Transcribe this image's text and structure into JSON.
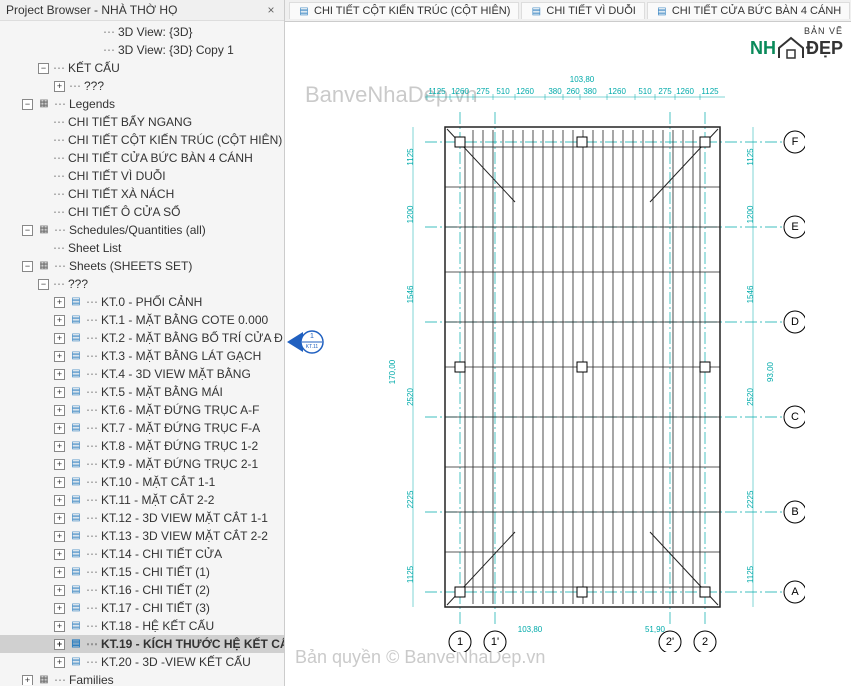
{
  "sidebar": {
    "title": "Project Browser - NHÀ THỜ HỌ",
    "close": "×",
    "tree": [
      {
        "indent": 5,
        "expander": "",
        "icon": "",
        "label": "3D View: {3D}",
        "active": false
      },
      {
        "indent": 5,
        "expander": "",
        "icon": "",
        "label": "3D View: {3D} Copy 1",
        "active": false
      },
      {
        "indent": 2,
        "expander": "−",
        "icon": "",
        "label": "KẾT CẤU",
        "active": false
      },
      {
        "indent": 3,
        "expander": "+",
        "icon": "",
        "label": "???",
        "active": false
      },
      {
        "indent": 1,
        "expander": "−",
        "icon": "folder",
        "label": "Legends",
        "active": false
      },
      {
        "indent": 2,
        "expander": "",
        "icon": "",
        "label": "CHI TIẾT BẨY NGANG",
        "active": false
      },
      {
        "indent": 2,
        "expander": "",
        "icon": "",
        "label": "CHI TIẾT CỘT KIẾN TRÚC (CỘT HIÊN)",
        "active": false
      },
      {
        "indent": 2,
        "expander": "",
        "icon": "",
        "label": "CHI TIẾT CỬA BỨC BÀN 4 CÁNH",
        "active": false
      },
      {
        "indent": 2,
        "expander": "",
        "icon": "",
        "label": "CHI TIẾT VÌ DUỖI",
        "active": false
      },
      {
        "indent": 2,
        "expander": "",
        "icon": "",
        "label": "CHI TIẾT XÀ NÁCH",
        "active": false
      },
      {
        "indent": 2,
        "expander": "",
        "icon": "",
        "label": "CHI TIẾT Ô CỬA SỔ",
        "active": false
      },
      {
        "indent": 1,
        "expander": "−",
        "icon": "folder",
        "label": "Schedules/Quantities (all)",
        "active": false
      },
      {
        "indent": 2,
        "expander": "",
        "icon": "",
        "label": "Sheet List",
        "active": false
      },
      {
        "indent": 1,
        "expander": "−",
        "icon": "folder",
        "label": "Sheets (SHEETS SET)",
        "active": false
      },
      {
        "indent": 2,
        "expander": "−",
        "icon": "",
        "label": "???",
        "active": false
      },
      {
        "indent": 3,
        "expander": "+",
        "icon": "sheet",
        "label": "KT.0 - PHỐI CẢNH",
        "active": false
      },
      {
        "indent": 3,
        "expander": "+",
        "icon": "sheet",
        "label": "KT.1 - MẶT BẰNG COTE 0.000",
        "active": false
      },
      {
        "indent": 3,
        "expander": "+",
        "icon": "sheet",
        "label": "KT.2 - MẶT BẰNG BỐ TRÍ CỬA Đ",
        "active": false
      },
      {
        "indent": 3,
        "expander": "+",
        "icon": "sheet",
        "label": "KT.3 - MẶT BẰNG LÁT GẠCH",
        "active": false
      },
      {
        "indent": 3,
        "expander": "+",
        "icon": "sheet",
        "label": "KT.4 - 3D VIEW MẶT BẰNG",
        "active": false
      },
      {
        "indent": 3,
        "expander": "+",
        "icon": "sheet",
        "label": "KT.5 - MẶT BẰNG MÁI",
        "active": false
      },
      {
        "indent": 3,
        "expander": "+",
        "icon": "sheet",
        "label": "KT.6 - MẶT ĐỨNG TRỤC A-F",
        "active": false
      },
      {
        "indent": 3,
        "expander": "+",
        "icon": "sheet",
        "label": "KT.7 - MẶT ĐỨNG TRỤC F-A",
        "active": false
      },
      {
        "indent": 3,
        "expander": "+",
        "icon": "sheet",
        "label": "KT.8 - MẶT ĐỨNG TRỤC 1-2",
        "active": false
      },
      {
        "indent": 3,
        "expander": "+",
        "icon": "sheet",
        "label": "KT.9 - MẶT ĐỨNG TRỤC 2-1",
        "active": false
      },
      {
        "indent": 3,
        "expander": "+",
        "icon": "sheet",
        "label": "KT.10 - MẶT CẮT 1-1",
        "active": false
      },
      {
        "indent": 3,
        "expander": "+",
        "icon": "sheet",
        "label": "KT.11 - MẶT CẮT 2-2",
        "active": false
      },
      {
        "indent": 3,
        "expander": "+",
        "icon": "sheet",
        "label": "KT.12 - 3D VIEW MẶT CẮT 1-1",
        "active": false
      },
      {
        "indent": 3,
        "expander": "+",
        "icon": "sheet",
        "label": "KT.13 - 3D VIEW MẶT CẮT 2-2",
        "active": false
      },
      {
        "indent": 3,
        "expander": "+",
        "icon": "sheet",
        "label": "KT.14 - CHI TIẾT CỬA",
        "active": false
      },
      {
        "indent": 3,
        "expander": "+",
        "icon": "sheet",
        "label": "KT.15 - CHI TIẾT (1)",
        "active": false
      },
      {
        "indent": 3,
        "expander": "+",
        "icon": "sheet",
        "label": "KT.16 - CHI TIẾT (2)",
        "active": false
      },
      {
        "indent": 3,
        "expander": "+",
        "icon": "sheet",
        "label": "KT.17 - CHI TIẾT (3)",
        "active": false
      },
      {
        "indent": 3,
        "expander": "+",
        "icon": "sheet",
        "label": "KT.18 - HỆ KẾT CẤU",
        "active": false
      },
      {
        "indent": 3,
        "expander": "+",
        "icon": "sheet",
        "label": "KT.19 - KÍCH THƯỚC HỆ KẾT CẤ",
        "active": true
      },
      {
        "indent": 3,
        "expander": "+",
        "icon": "sheet",
        "label": "KT.20 - 3D -VIEW KẾT CẤU",
        "active": false
      },
      {
        "indent": 1,
        "expander": "+",
        "icon": "folder",
        "label": "Families",
        "active": false
      }
    ]
  },
  "tabs": [
    {
      "label": "CHI TIẾT CỘT KIẾN TRÚC (CỘT HIÊN)"
    },
    {
      "label": "CHI TIẾT VÌ DUỖI"
    },
    {
      "label": "CHI TIẾT CỬA BỨC BÀN 4 CÁNH"
    }
  ],
  "logo": {
    "top": "BẢN VẼ",
    "brand1": "NH",
    "brand2": "ĐẸP"
  },
  "watermarks": {
    "top": "BanveNhaDep.vn",
    "bottom": "Bản quyền © BanveNhaDep.vn"
  },
  "drawing": {
    "grid_rows": [
      "F",
      "E",
      "D",
      "C",
      "B",
      "A"
    ],
    "grid_cols": [
      "1",
      "1'",
      "2'",
      "2"
    ],
    "dims_top": [
      "1125",
      "1260",
      "275",
      "510",
      "1260",
      "380",
      "260",
      "380",
      "1260",
      "510",
      "275",
      "1260",
      "1125"
    ],
    "dims_left_major": "170,00",
    "dims_right_major": "93,00",
    "dims_side": [
      "1125",
      "1200",
      "1546",
      "2520",
      "2225",
      "1125"
    ],
    "dims_bottom_major": [
      "103,80",
      "51,90"
    ],
    "section": {
      "num": "1",
      "ref": "KT.11"
    }
  }
}
